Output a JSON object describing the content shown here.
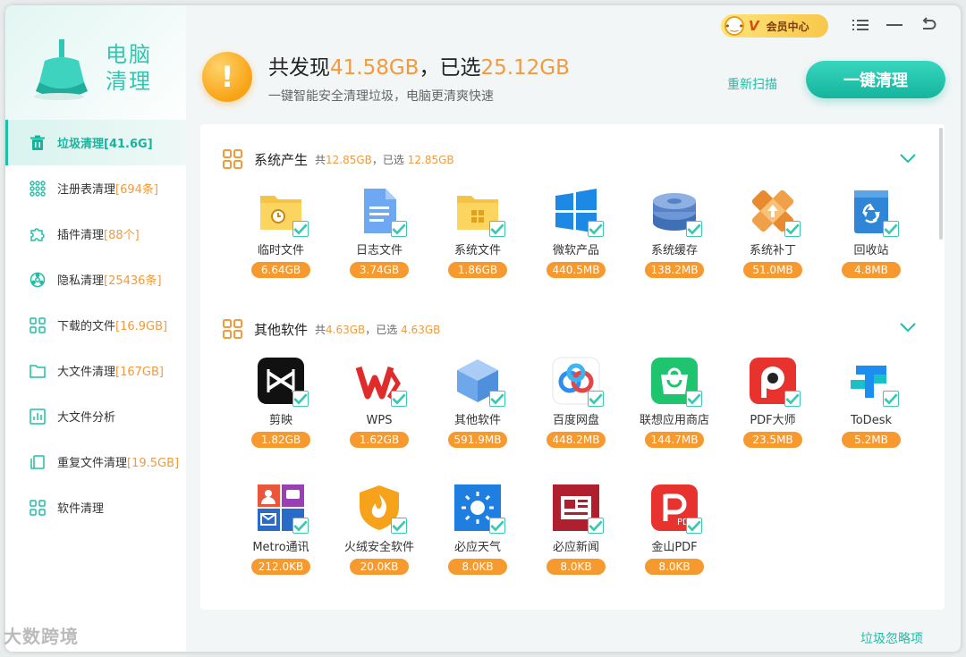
{
  "brand": {
    "logo_text_line1": "电脑",
    "logo_text_line2": "清理"
  },
  "sidebar": {
    "items": [
      {
        "label": "垃圾清理",
        "count": "[41.6G]",
        "icon": "trash-icon"
      },
      {
        "label": "注册表清理",
        "count": "[694条]",
        "icon": "registry-icon"
      },
      {
        "label": "插件清理",
        "count": "[88个]",
        "icon": "puzzle-icon"
      },
      {
        "label": "隐私清理",
        "count": "[25436条]",
        "icon": "privacy-icon"
      },
      {
        "label": "下载的文件",
        "count": "[16.9GB]",
        "icon": "download-grid-icon"
      },
      {
        "label": "大文件清理",
        "count": "[167GB]",
        "icon": "folder-icon"
      },
      {
        "label": "大文件分析",
        "count": "",
        "icon": "bar-chart-icon"
      },
      {
        "label": "重复文件清理",
        "count": "[19.5GB]",
        "icon": "duplicate-icon"
      },
      {
        "label": "软件清理",
        "count": "",
        "icon": "apps-icon"
      }
    ]
  },
  "watermark": "大数跨境",
  "header": {
    "summary_prefix": "共发现",
    "summary_total": "41.58GB",
    "summary_mid": "，已选",
    "summary_selected": "25.12GB",
    "subtitle": "一键智能安全清理垃圾，电脑更清爽快速",
    "vip_label": "会员中心",
    "rescan_label": "重新扫描",
    "clean_label": "一键清理"
  },
  "sections": [
    {
      "title": "系统产生",
      "total_prefix": "共",
      "total": "12.85GB",
      "selected_prefix": "，已选 ",
      "selected": "12.85GB",
      "items": [
        {
          "name": "临时文件",
          "size": "6.64GB",
          "icon": "temp-folder-icon"
        },
        {
          "name": "日志文件",
          "size": "3.74GB",
          "icon": "log-file-icon"
        },
        {
          "name": "系统文件",
          "size": "1.86GB",
          "icon": "system-folder-icon"
        },
        {
          "name": "微软产品",
          "size": "440.5MB",
          "icon": "windows-icon"
        },
        {
          "name": "系统缓存",
          "size": "138.2MB",
          "icon": "cache-disk-icon"
        },
        {
          "name": "系统补丁",
          "size": "51.0MB",
          "icon": "patch-icon"
        },
        {
          "name": "回收站",
          "size": "4.8MB",
          "icon": "recycle-bin-icon"
        }
      ]
    },
    {
      "title": "其他软件",
      "total_prefix": "共",
      "total": "4.63GB",
      "selected_prefix": "，已选 ",
      "selected": "4.63GB",
      "items": [
        {
          "name": "剪映",
          "size": "1.82GB",
          "icon": "capcut-icon"
        },
        {
          "name": "WPS",
          "size": "1.62GB",
          "icon": "wps-icon"
        },
        {
          "name": "其他软件",
          "size": "591.9MB",
          "icon": "cube-icon"
        },
        {
          "name": "百度网盘",
          "size": "448.2MB",
          "icon": "baidu-netdisk-icon"
        },
        {
          "name": "联想应用商店",
          "size": "144.7MB",
          "icon": "lenovo-store-icon"
        },
        {
          "name": "PDF大师",
          "size": "23.5MB",
          "icon": "pdf-master-icon"
        },
        {
          "name": "ToDesk",
          "size": "5.2MB",
          "icon": "todesk-icon"
        },
        {
          "name": "Metro通讯",
          "size": "212.0KB",
          "icon": "metro-icon"
        },
        {
          "name": "火绒安全软件",
          "size": "20.0KB",
          "icon": "huorong-icon"
        },
        {
          "name": "必应天气",
          "size": "8.0KB",
          "icon": "bing-weather-icon"
        },
        {
          "name": "必应新闻",
          "size": "8.0KB",
          "icon": "bing-news-icon"
        },
        {
          "name": "金山PDF",
          "size": "8.0KB",
          "icon": "kingsoft-pdf-icon"
        }
      ]
    }
  ],
  "footer": {
    "ignore_label": "垃圾忽略项"
  },
  "colors": {
    "accent": "#1fbfa6",
    "orange": "#f39a3c"
  }
}
